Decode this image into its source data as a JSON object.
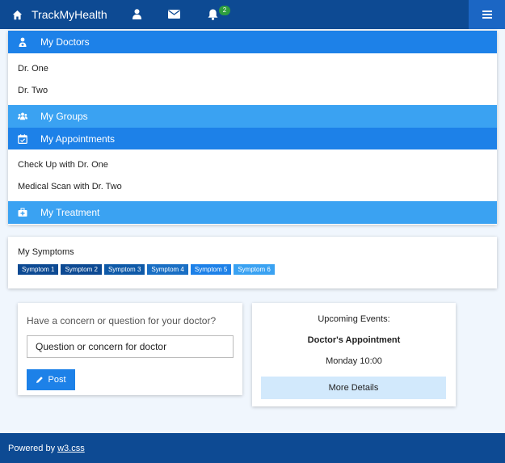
{
  "nav": {
    "brand": "TrackMyHealth",
    "notification_count": "2",
    "icons": [
      "home-icon",
      "user-icon",
      "envelope-icon",
      "bell-icon",
      "hamburger-icon"
    ]
  },
  "sidebar": {
    "doctors": {
      "label": "My Doctors",
      "items": [
        "Dr. One",
        "Dr. Two"
      ]
    },
    "groups": {
      "label": "My Groups"
    },
    "appointments": {
      "label": "My Appointments",
      "items": [
        "Check Up with Dr. One",
        "Medical Scan with Dr. Two"
      ]
    },
    "treatment": {
      "label": "My Treatment"
    }
  },
  "symptoms": {
    "title": "My Symptoms",
    "tags": [
      "Symptom 1",
      "Symptom 2",
      "Symptom 3",
      "Symptom 4",
      "Symptom 5",
      "Symptom 6"
    ],
    "tag_colors": [
      "#0d4a93",
      "#0d4a93",
      "#0f5aa8",
      "#1a6fc4",
      "#1d81e8",
      "#3aa2f2"
    ]
  },
  "question": {
    "title": "Have a concern or question for your doctor?",
    "input_value": "Question or concern for doctor",
    "post_label": "Post"
  },
  "events": {
    "title": "Upcoming Events:",
    "event_name": "Doctor's Appointment",
    "event_time": "Monday 10:00",
    "details_label": "More Details"
  },
  "footer": {
    "prefix": "Powered by",
    "link": "w3.css"
  },
  "colors": {
    "navbar": "#0d4a93",
    "accent_dark": "#1d81e8",
    "accent_light": "#3aa2f2",
    "success_badge": "#2e9e3e",
    "background": "#f0f6fd"
  }
}
